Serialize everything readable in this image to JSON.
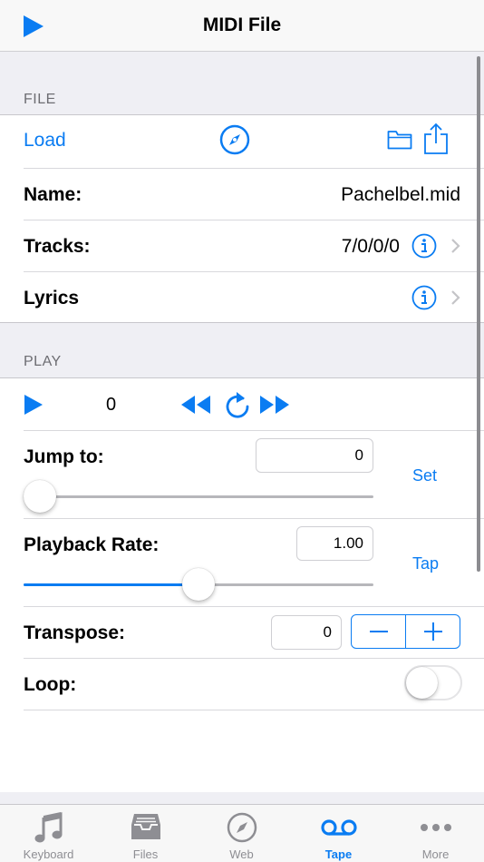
{
  "nav": {
    "title": "MIDI File",
    "play_icon": "play-icon"
  },
  "file_section": {
    "header": "FILE",
    "load_label": "Load",
    "name_label": "Name:",
    "name_value": "Pachelbel.mid",
    "tracks_label": "Tracks:",
    "tracks_value": "7/0/0/0",
    "lyrics_label": "Lyrics"
  },
  "play_section": {
    "header": "PLAY",
    "position": "0",
    "jump_label": "Jump to:",
    "jump_value": "0",
    "jump_slider": 0.0,
    "set_label": "Set",
    "rate_label": "Playback Rate:",
    "rate_value": "1.00",
    "rate_slider": 0.5,
    "tap_label": "Tap",
    "transpose_label": "Transpose:",
    "transpose_value": "0",
    "loop_label": "Loop:",
    "loop_on": false
  },
  "tabs": [
    {
      "label": "Keyboard",
      "icon": "music-note-icon",
      "active": false
    },
    {
      "label": "Files",
      "icon": "tray-icon",
      "active": false
    },
    {
      "label": "Web",
      "icon": "compass-icon",
      "active": false
    },
    {
      "label": "Tape",
      "icon": "tape-icon",
      "active": true
    },
    {
      "label": "More",
      "icon": "more-icon",
      "active": false
    }
  ],
  "colors": {
    "accent": "#0a7cf2",
    "inactive": "#8e8e93",
    "background": "#efeff4"
  }
}
